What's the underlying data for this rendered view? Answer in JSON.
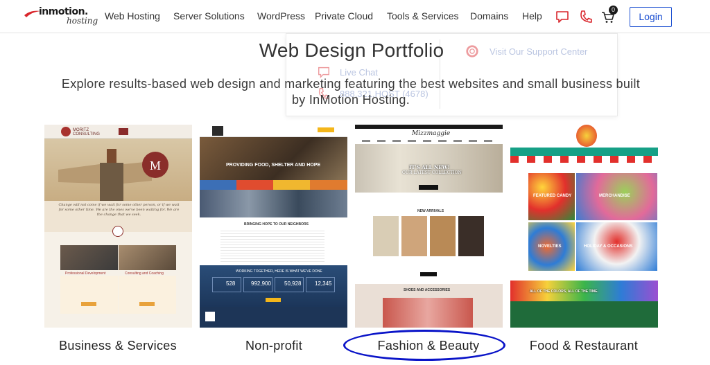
{
  "header": {
    "logo_main": "inmotion.",
    "logo_sub": "hosting",
    "nav_items": [
      "Web Hosting",
      "Server Solutions",
      "WordPress",
      "Private Cloud",
      "Tools & Services",
      "Domains",
      "Help"
    ],
    "cart_count": "0",
    "login_label": "Login"
  },
  "help_menu": {
    "left_items": [
      "Live Chat",
      "888.321.HOST (4678)"
    ],
    "right_items": [
      "Visit Our Support Center"
    ]
  },
  "page": {
    "title": "Web Design Portfolio",
    "lead": "Explore results-based web design and marketing featuring the best websites and small business built by InMotion Hosting."
  },
  "portfolio": [
    {
      "caption": "Business & Services",
      "texts": [
        "MORITZ CONSULTING",
        "Change will not come if we wait for some other person, or if we wait for some other time. We are the ones we've been waiting for. We are the change that we seek.",
        "Professional Development",
        "Consulting and Coaching"
      ]
    },
    {
      "caption": "Non-profit",
      "texts": [
        "PROVIDING FOOD, SHELTER AND HOPE",
        "BRINGING HOPE TO OUR NEIGHBORS",
        "WORKING TOGETHER, HERE IS WHAT WE'VE DONE",
        "528",
        "992,900",
        "50,928",
        "12,345"
      ]
    },
    {
      "caption": "Fashion & Beauty",
      "texts": [
        "Mizzmaggie",
        "IT'S ALL NEW!",
        "OUR LATEST COLLECTION",
        "SHOP NOW",
        "NEW ARRIVALS",
        "SHOES AND ACCESSORIES"
      ]
    },
    {
      "caption": "Food & Restaurant",
      "texts": [
        "FEATURED CANDY",
        "MERCHANDISE",
        "NOVELTIES",
        "HOLIDAY & OCCASIONS",
        "ALL OF THE COLORS, ALL OF THE TIME."
      ]
    }
  ],
  "colors": {
    "accent": "#1b4fd1",
    "brand_red": "#d9262c",
    "highlight_oval": "#0a14c8"
  }
}
